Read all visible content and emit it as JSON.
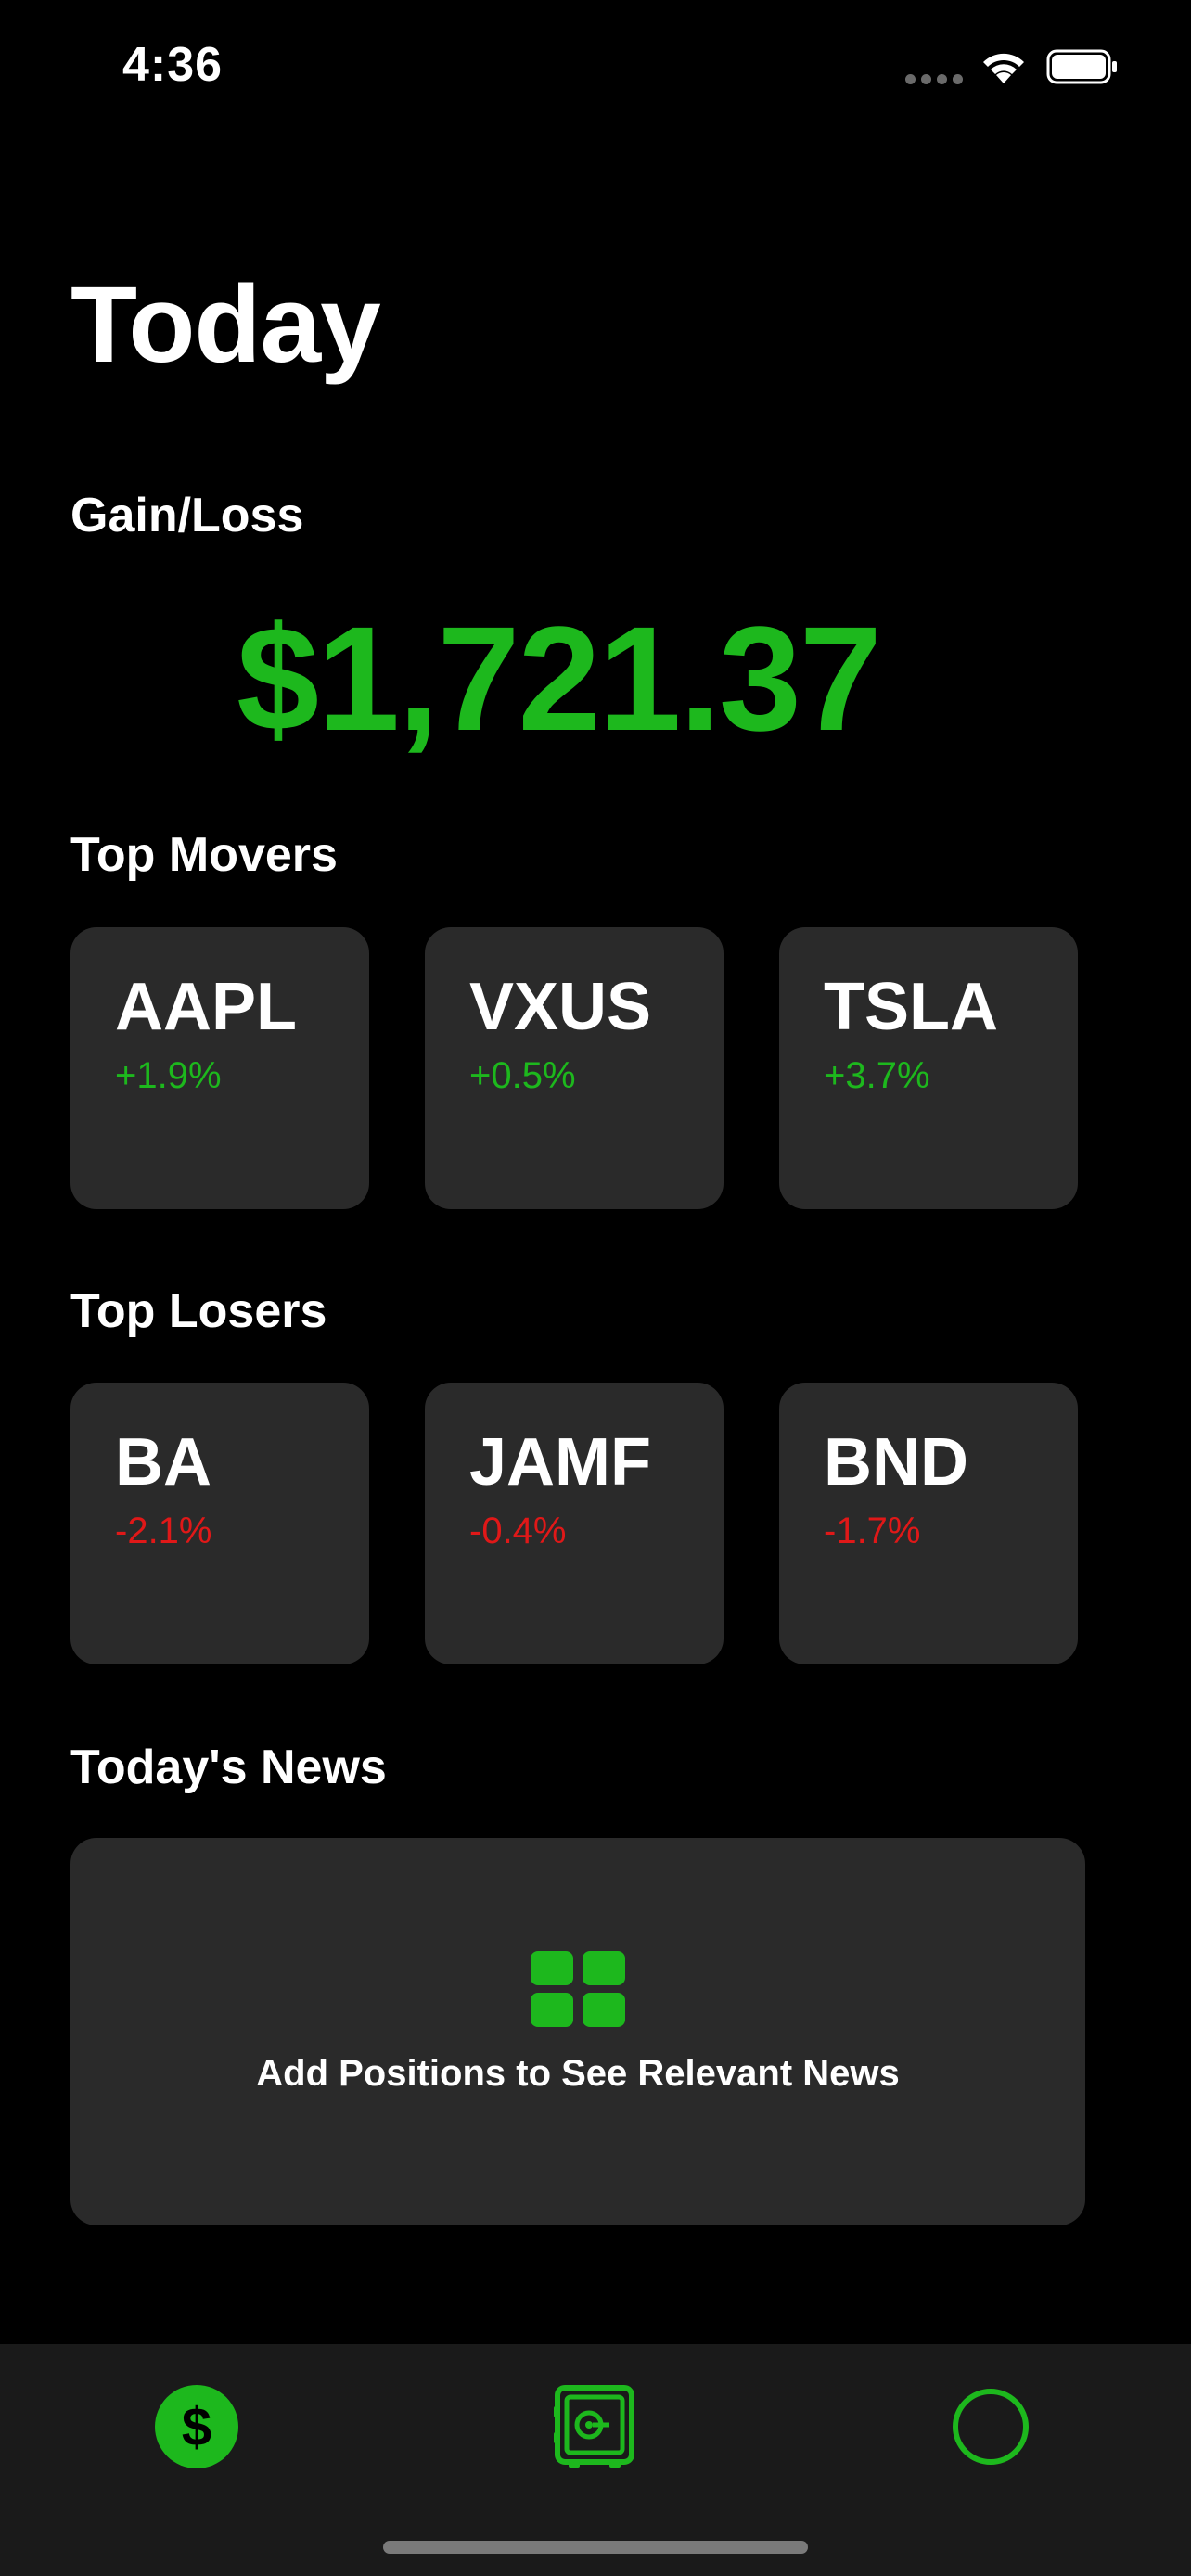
{
  "status_bar": {
    "time": "4:36"
  },
  "page": {
    "title": "Today"
  },
  "gain_loss": {
    "label": "Gain/Loss",
    "value": "$1,721.37"
  },
  "top_movers": {
    "label": "Top Movers",
    "items": [
      {
        "symbol": "AAPL",
        "change": "+1.9%"
      },
      {
        "symbol": "VXUS",
        "change": "+0.5%"
      },
      {
        "symbol": "TSLA",
        "change": "+3.7%"
      }
    ]
  },
  "top_losers": {
    "label": "Top Losers",
    "items": [
      {
        "symbol": "BA",
        "change": "-2.1%"
      },
      {
        "symbol": "JAMF",
        "change": "-0.4%"
      },
      {
        "symbol": "BND",
        "change": "-1.7%"
      }
    ]
  },
  "news": {
    "label": "Today's News",
    "empty_message": "Add Positions to See Relevant News",
    "icon": "grid-icon"
  },
  "tab_bar": {
    "tabs": [
      {
        "icon": "dollar-icon",
        "symbol": "$",
        "selected": true
      },
      {
        "icon": "safe-icon",
        "selected": false
      },
      {
        "icon": "circle-icon",
        "selected": false
      }
    ]
  },
  "colors": {
    "accent": "#1db81d",
    "negative": "#e01818",
    "card": "#2a2a2a",
    "background": "#000000",
    "tab_bar": "#1a1a1a"
  }
}
